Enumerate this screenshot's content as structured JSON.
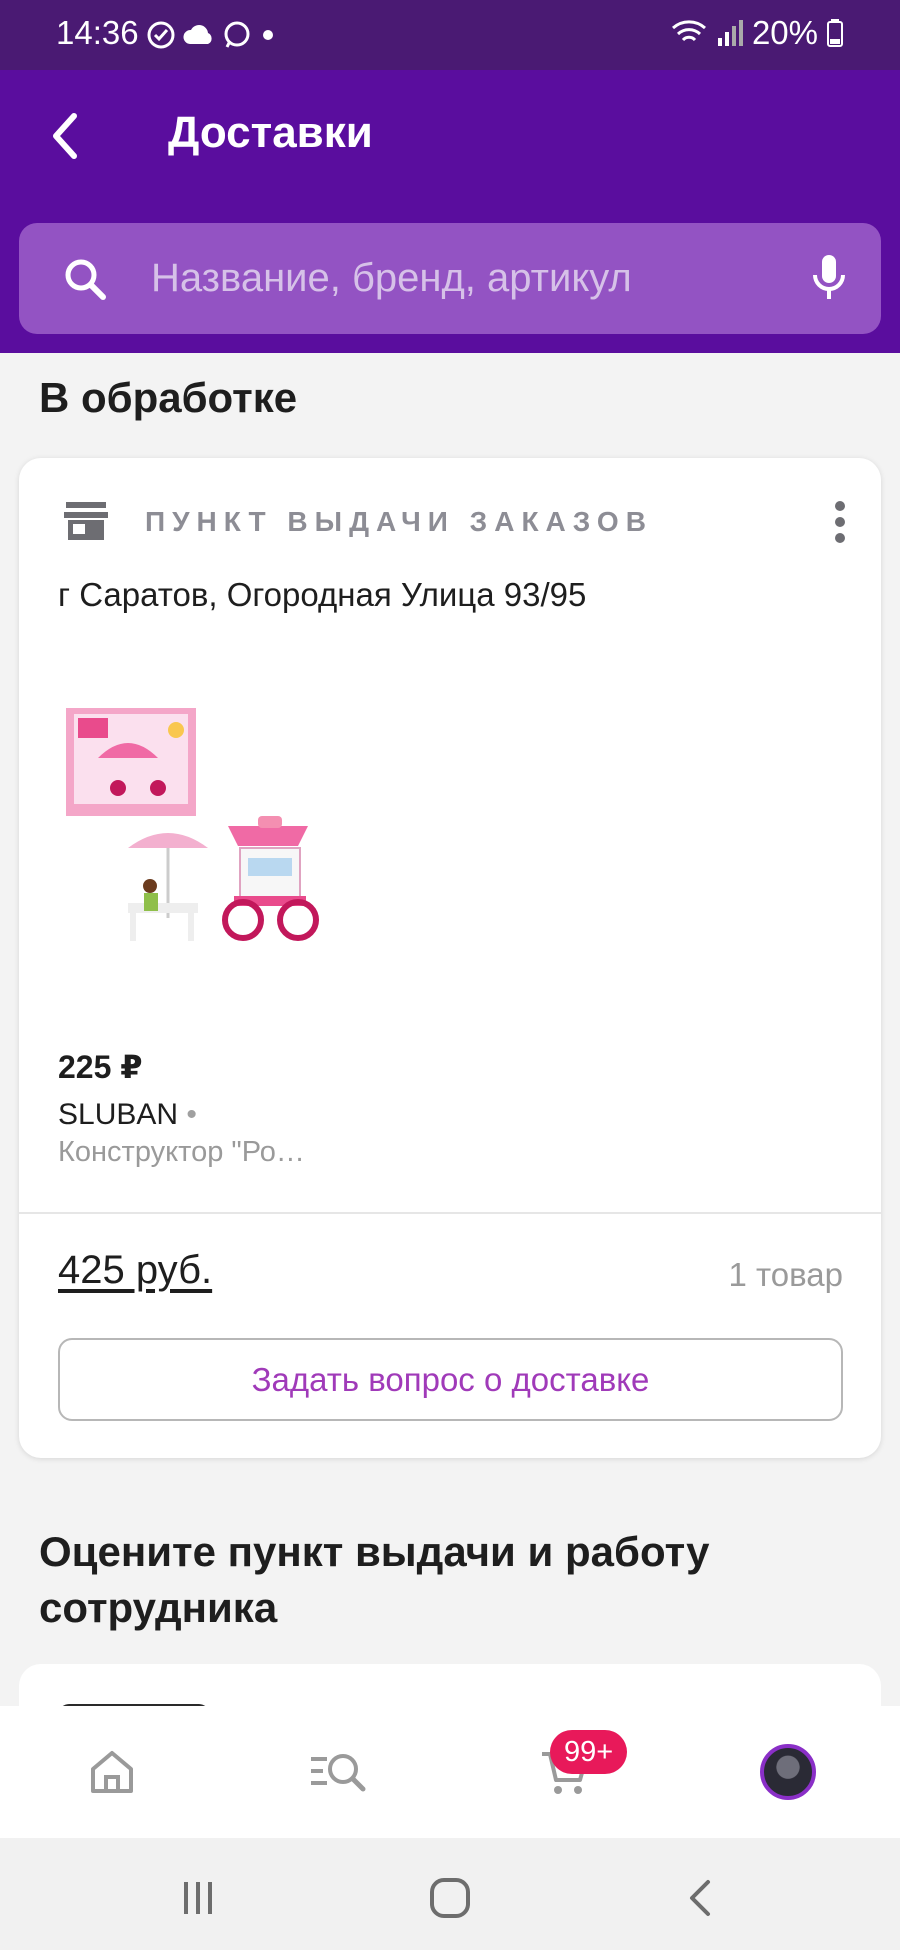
{
  "status_bar": {
    "time": "14:36",
    "battery": "20%"
  },
  "header": {
    "title": "Доставки"
  },
  "search": {
    "placeholder": "Название, бренд, артикул"
  },
  "section_processing": {
    "title": "В обработке"
  },
  "delivery_card": {
    "pickup_label": "ПУНКТ ВЫДАЧИ ЗАКАЗОВ",
    "address": "г Саратов, Огородная Улица 93/95",
    "product": {
      "price": "225 ₽",
      "brand": "SLUBAN",
      "brand_separator": "•",
      "name": "Конструктор \"Ро…"
    },
    "total": "425 руб.",
    "item_count": "1 товар",
    "ask_button": "Задать вопрос о доставке"
  },
  "section_rate": {
    "title_line1": "Оцените пункт выдачи и работу",
    "title_line2": "сотрудника"
  },
  "bottom_nav": {
    "cart_badge": "99+",
    "items": [
      "home-icon",
      "catalog-search-icon",
      "cart-icon",
      "profile-avatar"
    ]
  },
  "colors": {
    "header_bg": "#5a0d9e",
    "status_bg": "#4a1a73",
    "search_bg": "#9353c3",
    "accent_text": "#a03ab9",
    "badge": "#e8195a"
  }
}
